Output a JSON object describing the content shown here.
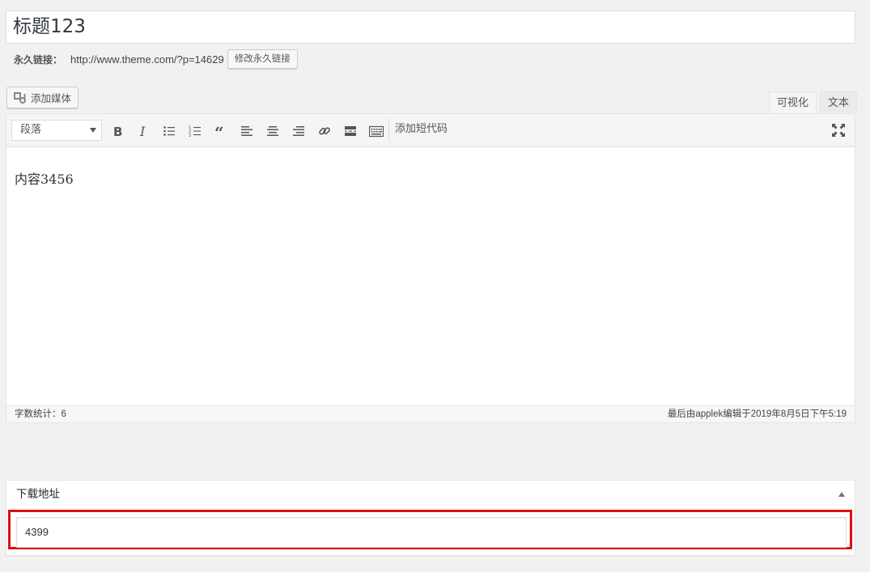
{
  "post": {
    "title": "标题123",
    "permalink_label": "永久链接：",
    "permalink_url": "http://www.theme.com/?p=14629",
    "edit_permalink_label": "修改永久链接"
  },
  "editor": {
    "add_media_label": "添加媒体",
    "tabs": [
      {
        "label": "可视化",
        "active": true
      },
      {
        "label": "文本",
        "active": false
      }
    ],
    "format_select_value": "段落",
    "add_shortcode_label": "添加短代码",
    "content": "内容3456",
    "word_count": "字数统计：6",
    "last_edited": "最后由applek编辑于2019年8月5日下午5:19"
  },
  "metabox": {
    "title": "下载地址",
    "value": "4399",
    "highlight_color": "#dd1111"
  },
  "toolbar_icons": [
    "bold-icon",
    "italic-icon",
    "bullet-list-icon",
    "numbered-list-icon",
    "blockquote-icon",
    "align-left-icon",
    "align-center-icon",
    "align-right-icon",
    "link-icon",
    "read-more-icon",
    "toolbar-toggle-icon",
    "fullscreen-icon"
  ]
}
